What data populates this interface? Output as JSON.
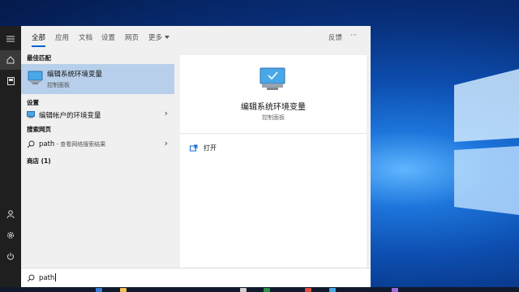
{
  "tabs": [
    {
      "label": "全部",
      "active": true
    },
    {
      "label": "应用"
    },
    {
      "label": "文档"
    },
    {
      "label": "设置"
    },
    {
      "label": "网页"
    },
    {
      "label": "更多"
    }
  ],
  "header": {
    "feedback": "反馈",
    "more_options": "···"
  },
  "sections": {
    "best_match": "最佳匹配",
    "settings": "设置",
    "web": "搜索网页",
    "store": "商店 (1)"
  },
  "best_match_item": {
    "title": "编辑系统环境变量",
    "subtitle": "控制面板"
  },
  "settings_item": {
    "label": "编辑帐户的环境变量"
  },
  "web_item": {
    "query": "path",
    "suffix": " - 查看网络搜索结果"
  },
  "preview": {
    "title": "编辑系统环境变量",
    "subtitle": "控制面板",
    "action_open": "打开"
  },
  "search": {
    "query": "path"
  },
  "colors": {
    "accent": "#0a64d4",
    "selected_row": "#b7cfea",
    "rail": "#1f1f1f"
  },
  "icons": [
    "menu-icon",
    "home-icon",
    "document-icon",
    "user-icon",
    "gear-icon",
    "power-icon",
    "search-icon",
    "monitor-icon",
    "open-icon"
  ]
}
